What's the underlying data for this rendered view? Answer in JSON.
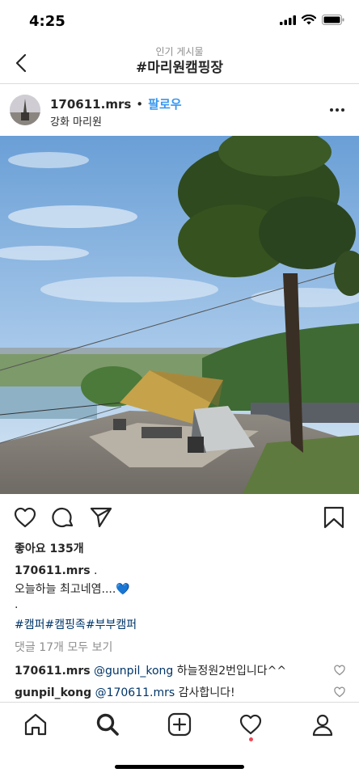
{
  "status_bar": {
    "time": "4:25"
  },
  "nav": {
    "subtitle": "인기 게시물",
    "title": "#마리원캠핑장"
  },
  "post": {
    "username": "170611.mrs",
    "separator": "•",
    "follow_label": "팔로우",
    "location": "강화 마리원",
    "likes": "좋아요 135개",
    "caption_username": "170611.mrs",
    "caption_suffix": ".",
    "caption_line1": "오늘하늘 최고네염....💙",
    "caption_line2": ".",
    "hashtags": "#캠퍼#캠핑족#부부캠퍼",
    "view_all_comments": "댓글 17개 모두 보기",
    "comments": [
      {
        "username": "170611.mrs",
        "mention": "@gunpil_kong",
        "text": "하늘정원2번입니다^^"
      },
      {
        "username": "gunpil_kong",
        "mention": "@170611.mrs",
        "text": "감사합니다!"
      }
    ]
  },
  "icons": {
    "back": "chevron-left-icon",
    "more": "more-icon",
    "like": "heart-icon",
    "comment": "comment-icon",
    "share": "send-icon",
    "save": "bookmark-icon",
    "home": "home-icon",
    "search": "search-icon",
    "add": "add-post-icon",
    "activity": "heart-icon",
    "profile": "profile-icon"
  },
  "colors": {
    "link_blue": "#3897f0",
    "hashtag": "#003569",
    "muted": "#8e8e8e",
    "notification": "#ed4956"
  }
}
